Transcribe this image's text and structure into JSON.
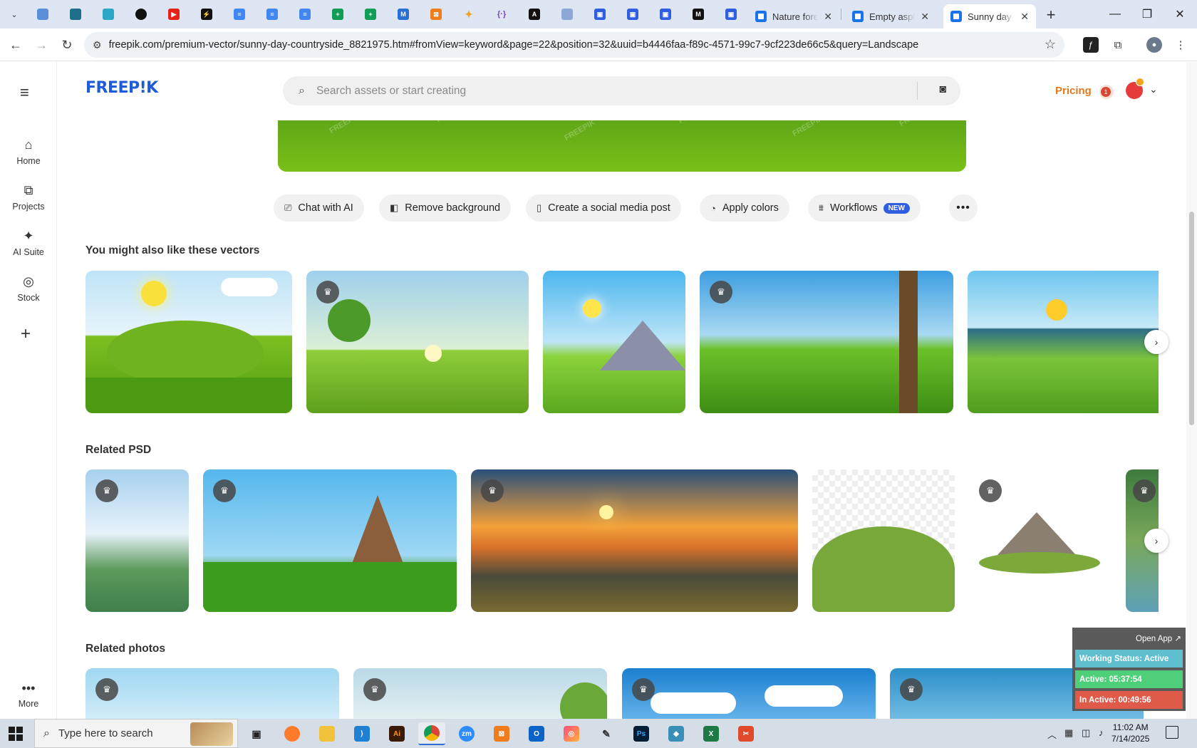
{
  "browser": {
    "tabs": [
      {
        "title": "Nature fore",
        "close": "✕"
      },
      {
        "title": "Empty asph",
        "close": "✕"
      },
      {
        "title": "Sunny day in",
        "close": "✕"
      }
    ],
    "new_tab": "+",
    "url": "freepik.com/premium-vector/sunny-day-countryside_8821975.htm#fromView=keyword&page=22&position=32&uuid=b4446faa-f89c-4571-99c7-9cf223de66c5&query=Landscape",
    "window_controls": {
      "minimize": "—",
      "maximize": "❐",
      "close": "✕"
    }
  },
  "site": {
    "logo": "FREEP!K",
    "search_placeholder": "Search assets or start creating",
    "pricing": "Pricing",
    "notification_count": "1"
  },
  "sidebar": {
    "items": [
      {
        "label": "Home",
        "icon": "home-icon"
      },
      {
        "label": "Projects",
        "icon": "projects-icon"
      },
      {
        "label": "AI Suite",
        "icon": "sparkle-icon"
      },
      {
        "label": "Stock",
        "icon": "stock-icon"
      }
    ],
    "more": "More"
  },
  "actions": {
    "chat": "Chat with AI",
    "remove_bg": "Remove background",
    "social": "Create a social media post",
    "colors": "Apply colors",
    "workflows": "Workflows",
    "new_badge": "NEW"
  },
  "sections": {
    "vectors": "You might also like these vectors",
    "psd": "Related PSD",
    "photos": "Related photos"
  },
  "tracker": {
    "open_app": "Open App ↗",
    "status": "Working Status: Active",
    "active": "Active: 05:37:54",
    "inactive": "In Active: 00:49:56"
  },
  "taskbar": {
    "search_text": "Type here to search",
    "time": "11:02 AM",
    "date": "7/14/2025"
  },
  "colors": {
    "brand": "#1d5bd8",
    "pricing": "#e07a1f",
    "status_active": "#5fbfcf",
    "active_green": "#4fcf7a",
    "inactive_red": "#e05a4a"
  }
}
